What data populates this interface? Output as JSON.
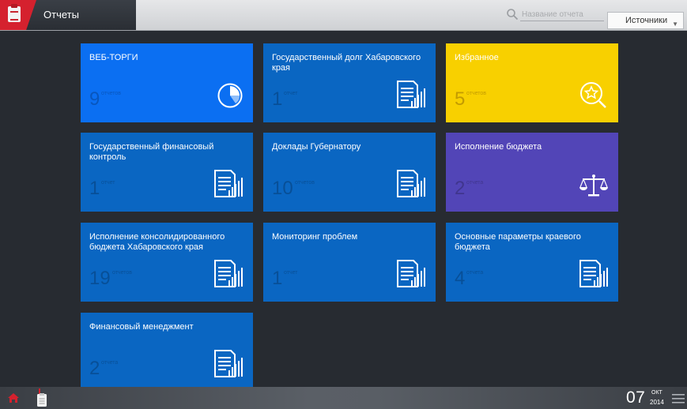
{
  "header": {
    "title": "Отчеты",
    "search_placeholder": "Название отчета",
    "sources_label": "Источники"
  },
  "tiles": [
    {
      "title": "ВЕБ-ТОРГИ",
      "count": "9",
      "unit": "отчетов",
      "icon": "pie-chart-icon",
      "color": "#0b6ff2"
    },
    {
      "title": "Государственный долг Хабаровского края",
      "count": "1",
      "unit": "отчет",
      "icon": "report-icon",
      "color": "#0a66c2"
    },
    {
      "title": "Избранное",
      "count": "5",
      "unit": "отчетов",
      "icon": "favorite-search-icon",
      "color": "#f8d000"
    },
    {
      "title": "Государственный финансовый контроль",
      "count": "1",
      "unit": "отчет",
      "icon": "report-icon",
      "color": "#0a66c2"
    },
    {
      "title": "Доклады Губернатору",
      "count": "10",
      "unit": "отчетов",
      "icon": "report-icon",
      "color": "#0a66c2"
    },
    {
      "title": "Исполнение бюджета",
      "count": "2",
      "unit": "отчета",
      "icon": "scales-icon",
      "color": "#5245b7"
    },
    {
      "title": "Исполнение консолидированного бюджета Хабаровского края",
      "count": "19",
      "unit": "отчетов",
      "icon": "report-icon",
      "color": "#0a66c2"
    },
    {
      "title": "Мониторинг проблем",
      "count": "1",
      "unit": "отчет",
      "icon": "report-icon",
      "color": "#0a66c2"
    },
    {
      "title": "Основные параметры краевого бюджета",
      "count": "4",
      "unit": "отчета",
      "icon": "report-icon",
      "color": "#0a66c2"
    },
    {
      "title": "Финансовый менеджмент",
      "count": "2",
      "unit": "отчета",
      "icon": "report-icon",
      "color": "#0a66c2"
    }
  ],
  "footer": {
    "day": "07",
    "month": "ОКТ",
    "year": "2014"
  }
}
